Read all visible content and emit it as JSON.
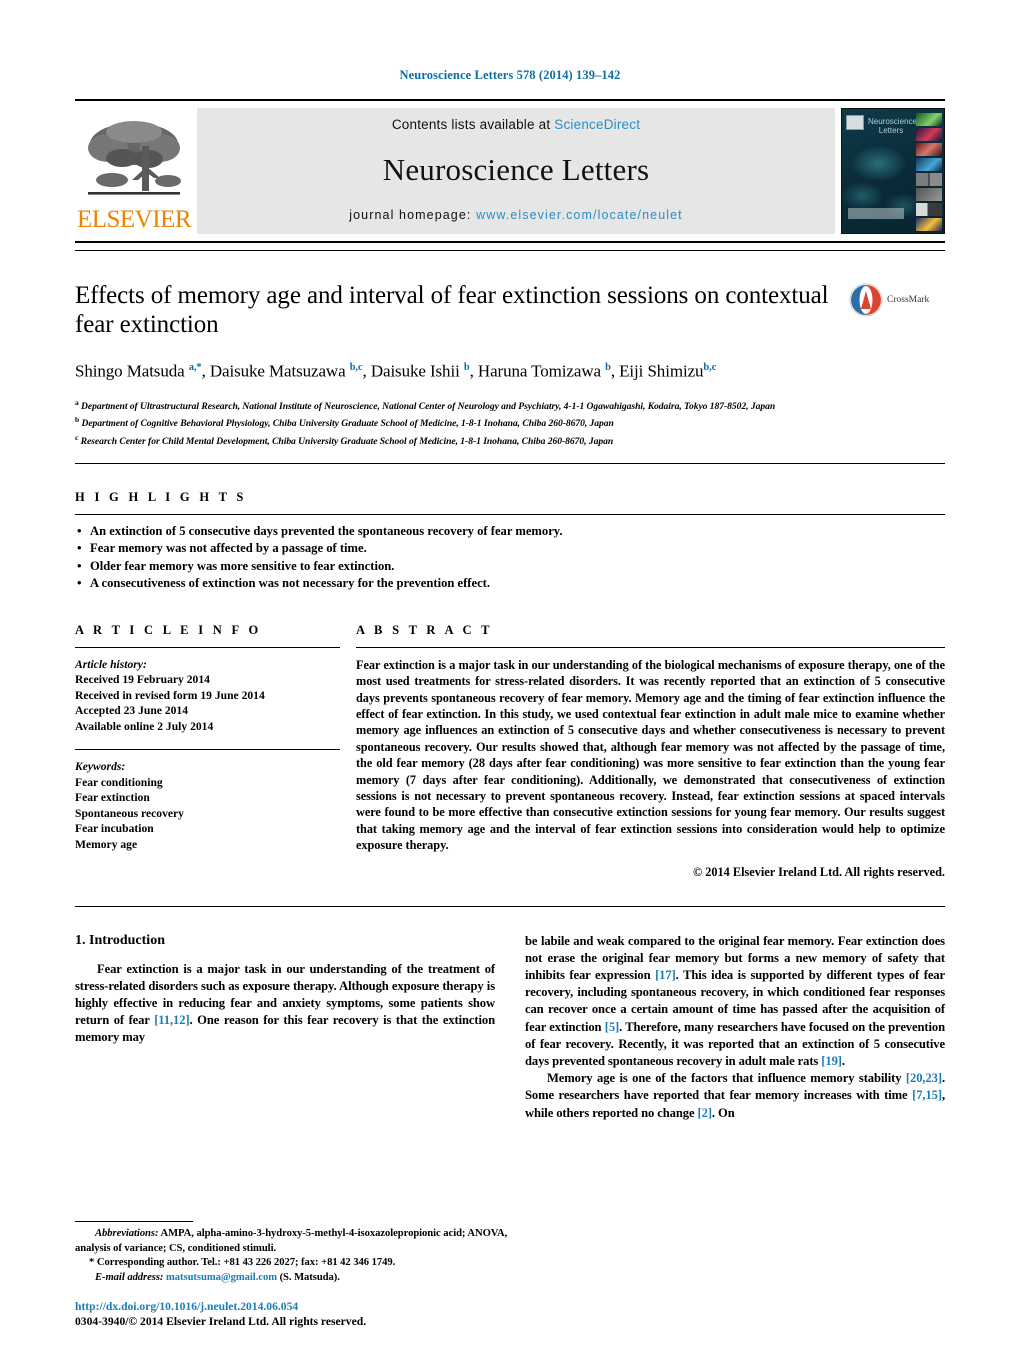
{
  "running_head": "Neuroscience Letters 578 (2014) 139–142",
  "masthead": {
    "publisher_logo_text": "ELSEVIER",
    "contents_prefix": "Contents lists available at ",
    "contents_link": "ScienceDirect",
    "journal_name": "Neuroscience Letters",
    "homepage_prefix": "journal homepage: ",
    "homepage_url": "www.elsevier.com/locate/neulet",
    "cover_title": "Neuroscience Letters",
    "colors": {
      "link_blue": "#2b8fc4",
      "elsevier_orange": "#ef8200",
      "band_gray": "#e6e6e6"
    }
  },
  "crossmark": {
    "label": "CrossMark"
  },
  "article": {
    "title": "Effects of memory age and interval of fear extinction sessions on contextual fear extinction",
    "authors_html": "Shingo Matsuda <sup class=\"star\">a,*</sup>, Daisuke Matsuzawa <sup>b,c</sup>, Daisuke Ishii <sup>b</sup>, Haruna Tomizawa <sup>b</sup>, Eiji Shimizu<sup>b,c</sup>",
    "affiliations": [
      "a Department of Ultrastructural Research, National Institute of Neuroscience, National Center of Neurology and Psychiatry, 4-1-1 Ogawahigashi, Kodaira, Tokyo 187-8502, Japan",
      "b Department of Cognitive Behavioral Physiology, Chiba University Graduate School of Medicine, 1-8-1 Inohana, Chiba 260-8670, Japan",
      "c Research Center for Child Mental Development, Chiba University Graduate School of Medicine, 1-8-1 Inohana, Chiba 260-8670, Japan"
    ]
  },
  "highlights": {
    "heading": "H I G H L I G H T S",
    "items": [
      "An extinction of 5 consecutive days prevented the spontaneous recovery of fear memory.",
      "Fear memory was not affected by a passage of time.",
      "Older fear memory was more sensitive to fear extinction.",
      "A consecutiveness of extinction was not necessary for the prevention effect."
    ]
  },
  "article_info": {
    "heading": "A R T I C L E    I N F O",
    "history_label": "Article history:",
    "history": [
      "Received 19 February 2014",
      "Received in revised form 19 June 2014",
      "Accepted 23 June 2014",
      "Available online 2 July 2014"
    ],
    "keywords_label": "Keywords:",
    "keywords": [
      "Fear conditioning",
      "Fear extinction",
      "Spontaneous recovery",
      "Fear incubation",
      "Memory age"
    ]
  },
  "abstract": {
    "heading": "A B S T R A C T",
    "text": "Fear extinction is a major task in our understanding of the biological mechanisms of exposure therapy, one of the most used treatments for stress-related disorders. It was recently reported that an extinction of 5 consecutive days prevents spontaneous recovery of fear memory. Memory age and the timing of fear extinction influence the effect of fear extinction. In this study, we used contextual fear extinction in adult male mice to examine whether memory age influences an extinction of 5 consecutive days and whether consecutiveness is necessary to prevent spontaneous recovery. Our results showed that, although fear memory was not affected by the passage of time, the old fear memory (28 days after fear conditioning) was more sensitive to fear extinction than the young fear memory (7 days after fear conditioning). Additionally, we demonstrated that consecutiveness of extinction sessions is not necessary to prevent spontaneous recovery. Instead, fear extinction sessions at spaced intervals were found to be more effective than consecutive extinction sessions for young fear memory. Our results suggest that taking memory age and the interval of fear extinction sessions into consideration would help to optimize exposure therapy.",
    "copyright": "© 2014 Elsevier Ireland Ltd. All rights reserved."
  },
  "introduction": {
    "section_number_title": "1.  Introduction",
    "left_paragraph_html": "Fear extinction is a major task in our understanding of the treatment of stress-related disorders such as exposure therapy. Although exposure therapy is highly effective in reducing fear and anxiety symptoms, some patients show return of fear <span class=\"ref\">[11,12]</span>. One reason for this fear recovery is that the extinction memory may",
    "right_paragraph_1_html": "be labile and weak compared to the original fear memory. Fear extinction does not erase the original fear memory but forms a new memory of safety that inhibits fear expression <span class=\"ref\">[17]</span>. This idea is supported by different types of fear recovery, including spontaneous recovery, in which conditioned fear responses can recover once a certain amount of time has passed after the acquisition of fear extinction <span class=\"ref\">[5]</span>. Therefore, many researchers have focused on the prevention of fear recovery. Recently, it was reported that an extinction of 5 consecutive days prevented spontaneous recovery in adult male rats <span class=\"ref\">[19]</span>.",
    "right_paragraph_2_html": "Memory age is one of the factors that influence memory stability <span class=\"ref\">[20,23]</span>. Some researchers have reported that fear memory increases with time <span class=\"ref\">[7,15]</span>, while others reported no change <span class=\"ref\">[2]</span>. On"
  },
  "footnotes": {
    "abbreviations_html": "<span class=\"it\">Abbreviations:</span>  AMPA, alpha-amino-3-hydroxy-5-methyl-4-isoxazolepropionic acid; ANOVA, analysis of variance; CS, conditioned stimuli.",
    "corresponding_html": "* Corresponding author. Tel.: +81 43 226 2027; fax: +81 42 346 1749.",
    "email_html": "<span class=\"it\">E-mail address:</span> <span class=\"mailto\">matsutsuma@gmail.com</span> (S. Matsuda)."
  },
  "footer": {
    "doi": "http://dx.doi.org/10.1016/j.neulet.2014.06.054",
    "issn_line": "0304-3940/© 2014 Elsevier Ireland Ltd. All rights reserved."
  }
}
